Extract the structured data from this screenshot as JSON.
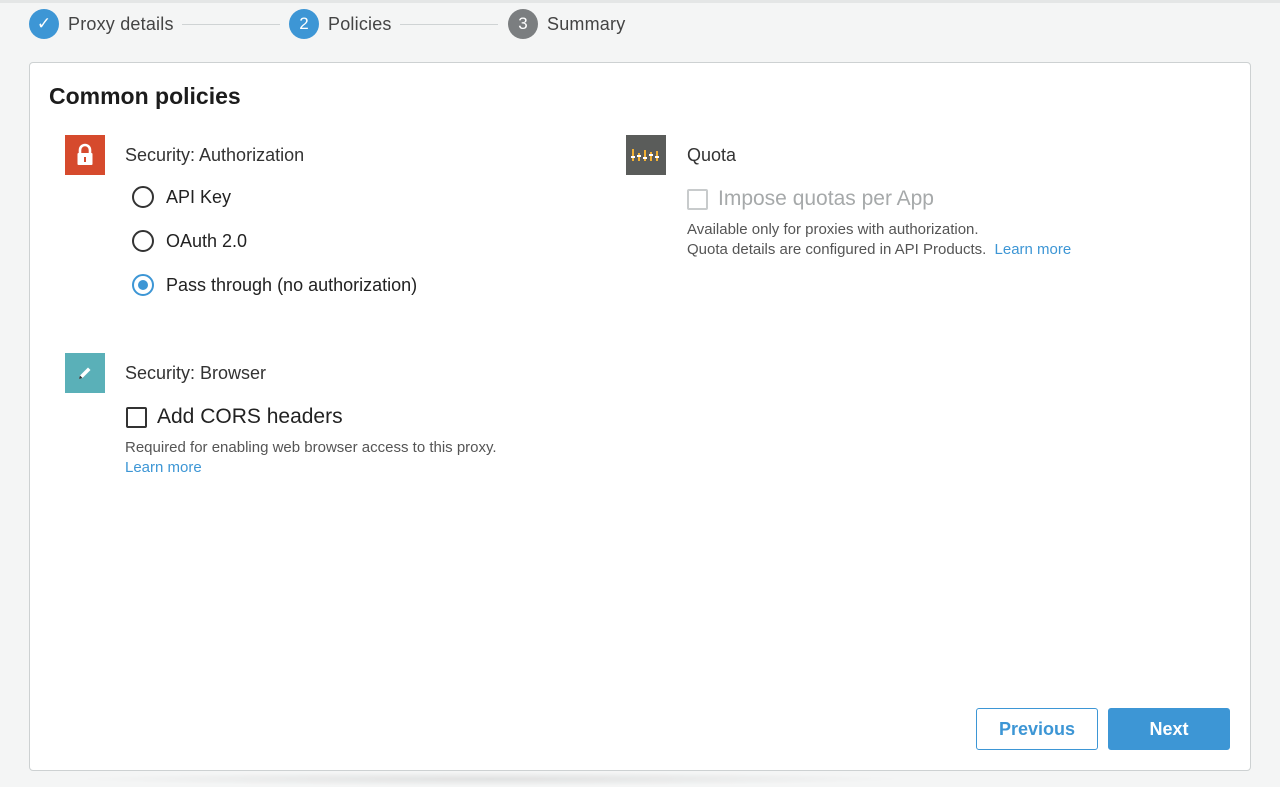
{
  "stepper": {
    "steps": [
      {
        "label": "Proxy details",
        "marker": "✓",
        "state": "done"
      },
      {
        "label": "Policies",
        "marker": "2",
        "state": "active"
      },
      {
        "label": "Summary",
        "marker": "3",
        "state": "pending"
      }
    ]
  },
  "card": {
    "title": "Common policies"
  },
  "security_authorization": {
    "label": "Security: Authorization",
    "icon": "lock-icon",
    "options": [
      {
        "label": "API Key",
        "checked": false
      },
      {
        "label": "OAuth 2.0",
        "checked": false
      },
      {
        "label": "Pass through (no authorization)",
        "checked": true
      }
    ]
  },
  "security_browser": {
    "label": "Security: Browser",
    "icon": "pencil-icon",
    "cors_label": "Add CORS headers",
    "cors_checked": false,
    "help_text": "Required for enabling web browser access to this proxy.",
    "learn_more": "Learn more"
  },
  "quota": {
    "label": "Quota",
    "icon": "equalizer-icon",
    "checkbox_label": "Impose quotas per App",
    "checkbox_disabled": true,
    "help_line1": "Available only for proxies with authorization.",
    "help_line2": "Quota details are configured in API Products.",
    "learn_more": "Learn more"
  },
  "actions": {
    "previous_label": "Previous",
    "next_label": "Next"
  },
  "colors": {
    "accent": "#3d96d5",
    "security_icon_bg": "#d64a2d",
    "browser_icon_bg": "#5ab0b8",
    "quota_icon_bg": "#5a5c5a",
    "pending_step": "#7b7e80"
  }
}
